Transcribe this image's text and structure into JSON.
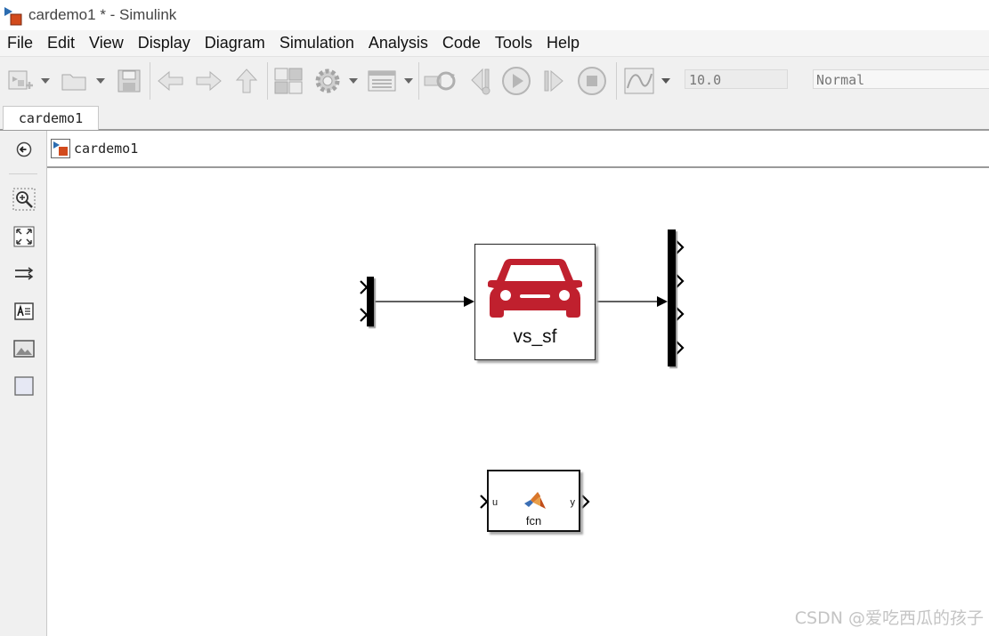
{
  "window": {
    "title": "cardemo1 * - Simulink",
    "app_icon": "simulink-model-icon"
  },
  "menu": [
    "File",
    "Edit",
    "View",
    "Display",
    "Diagram",
    "Simulation",
    "Analysis",
    "Code",
    "Tools",
    "Help"
  ],
  "toolbar": {
    "buttons": [
      {
        "name": "new-model-icon",
        "dropdown": true
      },
      {
        "name": "open-folder-icon",
        "dropdown": true
      },
      {
        "name": "save-icon"
      },
      {
        "name": "back-arrow-icon"
      },
      {
        "name": "forward-arrow-icon"
      },
      {
        "name": "up-arrow-icon"
      },
      {
        "name": "library-browser-icon"
      },
      {
        "name": "model-settings-gear-icon",
        "dropdown": true
      },
      {
        "name": "model-explorer-icon",
        "dropdown": true
      },
      {
        "name": "update-diagram-icon"
      },
      {
        "name": "step-back-icon"
      },
      {
        "name": "run-icon"
      },
      {
        "name": "step-forward-icon"
      },
      {
        "name": "stop-icon"
      },
      {
        "name": "data-inspector-icon",
        "dropdown": true
      }
    ],
    "stop_time": "10.0",
    "simulation_mode": "Normal"
  },
  "tabs": [
    {
      "label": "cardemo1",
      "active": true
    }
  ],
  "address": {
    "crumb": "cardemo1",
    "icon": "simulink-model-icon"
  },
  "palette": [
    {
      "name": "hide-explorer-bar-icon"
    },
    {
      "name": "zoom-icon"
    },
    {
      "name": "fit-to-view-icon"
    },
    {
      "name": "route-lines-icon"
    },
    {
      "name": "annotation-icon"
    },
    {
      "name": "image-icon"
    },
    {
      "name": "area-icon"
    }
  ],
  "diagram": {
    "blocks": [
      {
        "id": "vs_sf",
        "label": "vs_sf",
        "icon": "car-icon",
        "icon_color": "#c0202e"
      },
      {
        "id": "fcn",
        "label": "fcn",
        "icon": "matlab-logo-icon",
        "input_port": "u",
        "output_port": "y"
      },
      {
        "id": "mux",
        "type": "Mux",
        "inputs": 2
      },
      {
        "id": "demux",
        "type": "Demux",
        "outputs": 4
      }
    ]
  },
  "watermark": "CSDN @爱吃西瓜的孩子",
  "colors": {
    "car_red": "#c0202e",
    "toolbar_bg": "#f0f0f0",
    "canvas_bg": "#ffffff"
  }
}
